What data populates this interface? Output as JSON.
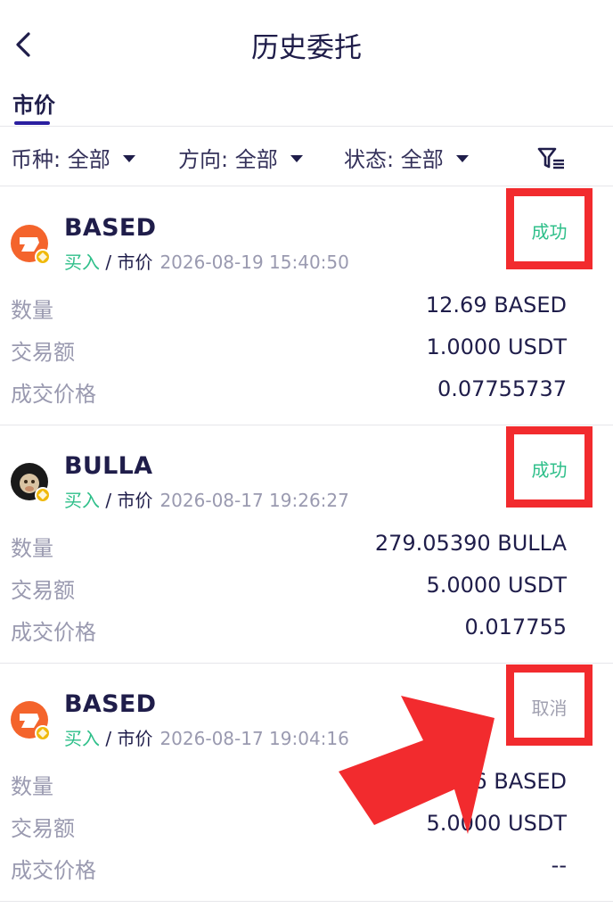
{
  "header": {
    "title": "历史委托"
  },
  "tabs": [
    {
      "label": "市价",
      "active": true
    }
  ],
  "filters": [
    {
      "label": "币种: 全部"
    },
    {
      "label": "方向: 全部"
    },
    {
      "label": "状态: 全部"
    }
  ],
  "colors": {
    "accent": "#2b1fa0",
    "success": "#2fbf8a",
    "highlight": "#f22b2e",
    "cancel": "#a0a0b0"
  },
  "orders": [
    {
      "symbol": "BASED",
      "icon": "based-coin-icon",
      "side": "买入",
      "sep": " / ",
      "order_type": "市价",
      "time": "2026-08-19 15:40:50",
      "status": "成功",
      "rows": [
        {
          "label": "数量",
          "value": "12.69 BASED"
        },
        {
          "label": "交易额",
          "value": "1.0000 USDT"
        },
        {
          "label": "成交价格",
          "value": "0.07755737"
        }
      ]
    },
    {
      "symbol": "BULLA",
      "icon": "bulla-coin-icon",
      "side": "买入",
      "sep": " / ",
      "order_type": "市价",
      "time": "2026-08-17 19:26:27",
      "status": "成功",
      "rows": [
        {
          "label": "数量",
          "value": "279.05390 BULLA"
        },
        {
          "label": "交易额",
          "value": "5.0000 USDT"
        },
        {
          "label": "成交价格",
          "value": "0.017755"
        }
      ]
    },
    {
      "symbol": "BASED",
      "icon": "based-coin-icon",
      "side": "买入",
      "sep": " / ",
      "order_type": "市价",
      "time": "2026-08-17 19:04:16",
      "status": "取消",
      "rows": [
        {
          "label": "数量",
          "value": "6 BASED"
        },
        {
          "label": "交易额",
          "value": "5.0000 USDT"
        },
        {
          "label": "成交价格",
          "value": "--"
        }
      ]
    }
  ]
}
